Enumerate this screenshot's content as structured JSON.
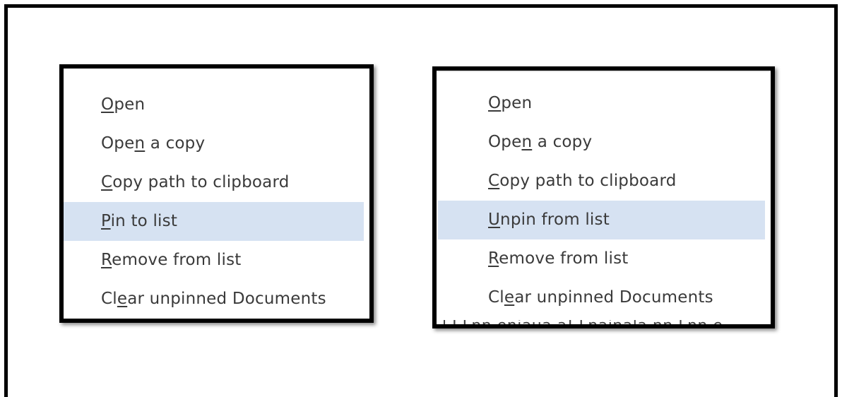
{
  "menus": {
    "left": {
      "items": [
        {
          "pre": "",
          "ul": "O",
          "post": "pen",
          "highlighted": false
        },
        {
          "pre": "Ope",
          "ul": "n",
          "post": " a copy",
          "highlighted": false
        },
        {
          "pre": "",
          "ul": "C",
          "post": "opy path to clipboard",
          "highlighted": false
        },
        {
          "pre": "",
          "ul": "P",
          "post": "in to list",
          "highlighted": true
        },
        {
          "pre": "",
          "ul": "R",
          "post": "emove from list",
          "highlighted": false
        },
        {
          "pre": "Cl",
          "ul": "e",
          "post": "ar unpinned Documents",
          "highlighted": false
        }
      ]
    },
    "right": {
      "items": [
        {
          "pre": "",
          "ul": "O",
          "post": "pen",
          "highlighted": false
        },
        {
          "pre": "Ope",
          "ul": "n",
          "post": " a copy",
          "highlighted": false
        },
        {
          "pre": "",
          "ul": "C",
          "post": "opy path to clipboard",
          "highlighted": false
        },
        {
          "pre": "",
          "ul": "U",
          "post": "npin from list",
          "highlighted": true
        },
        {
          "pre": "",
          "ul": "R",
          "post": "emove from list",
          "highlighted": false
        },
        {
          "pre": "Cl",
          "ul": "e",
          "post": "ar unpinned Documents",
          "highlighted": false
        }
      ],
      "cut_off_text": "l   Ǐ  Lnn eniaua a! Lnainala nn.Lnn e"
    }
  },
  "colors": {
    "highlight": "#d6e2f2",
    "frame": "#000000",
    "text": "#3a3a3a"
  }
}
